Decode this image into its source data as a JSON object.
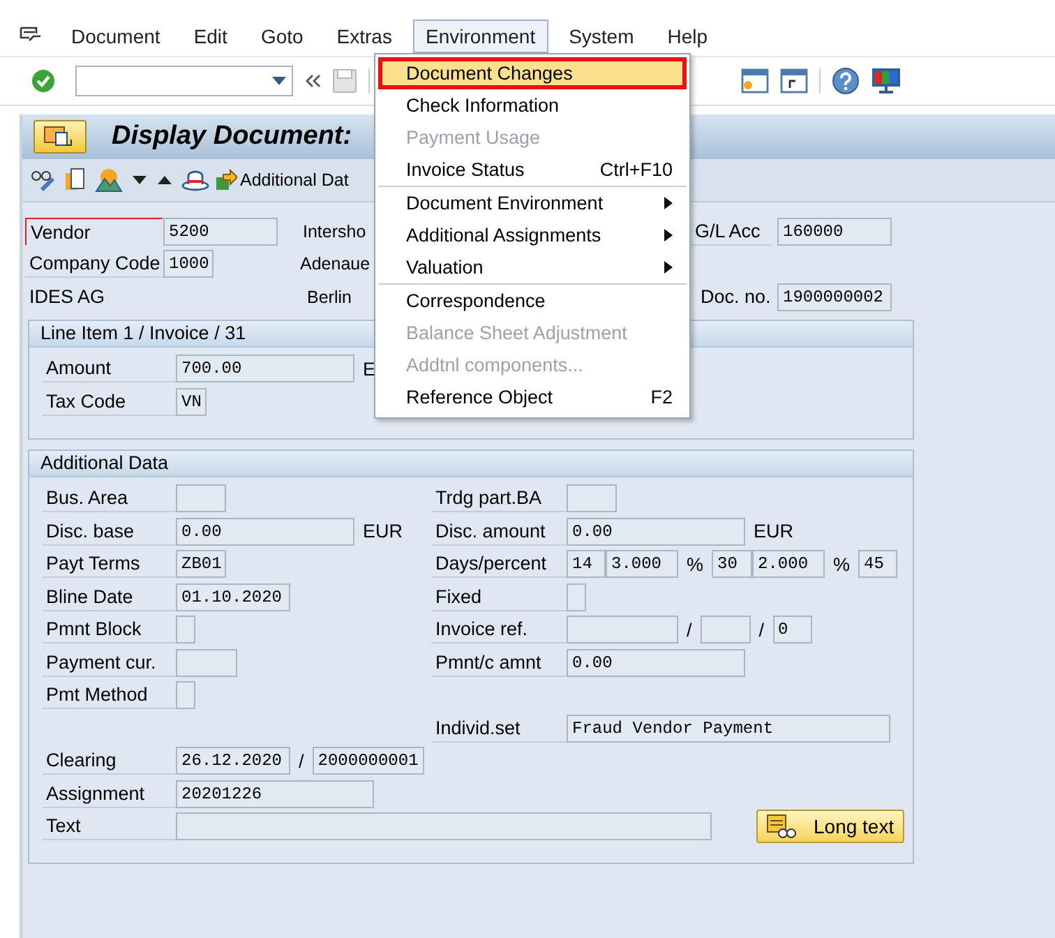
{
  "menu_bar": {
    "items": [
      {
        "label": "Document",
        "selected": false
      },
      {
        "label": "Edit",
        "selected": false
      },
      {
        "label": "Goto",
        "selected": false
      },
      {
        "label": "Extras",
        "selected": false
      },
      {
        "label": "Environment",
        "selected": true
      },
      {
        "label": "System",
        "selected": false
      },
      {
        "label": "Help",
        "selected": false
      }
    ]
  },
  "title": "Display Document:",
  "app_toolbar": {
    "button": "Additional Dat"
  },
  "header": {
    "vendor": {
      "label": "Vendor",
      "value": "5200"
    },
    "company_code": {
      "label": "Company Code",
      "value": "1000"
    },
    "company_name": "IDES AG",
    "vendor_lines": [
      "Intersho",
      "Adenaue",
      "Berlin"
    ],
    "gl_account": {
      "label": "G/L Acc",
      "value": "160000"
    },
    "document_number": {
      "label": "Doc. no.",
      "value": "1900000002"
    }
  },
  "line_item": {
    "title": "Line Item 1 / Invoice / 31",
    "rows": [
      {
        "label": "Amount",
        "parts": [
          {
            "kind": "field",
            "value": "700.00"
          },
          {
            "kind": "text",
            "text": "E"
          }
        ]
      },
      {
        "label": "Tax Code",
        "parts": [
          {
            "kind": "field",
            "value": "VN"
          }
        ]
      }
    ]
  },
  "additional_data": {
    "title": "Additional Data",
    "left": [
      {
        "label": "Bus. Area",
        "parts": [
          {
            "kind": "field"
          }
        ]
      },
      {
        "label": "Disc. base",
        "parts": [
          {
            "kind": "field",
            "value": "0.00"
          },
          {
            "kind": "text",
            "text": "EUR"
          }
        ]
      },
      {
        "label": "Payt Terms",
        "parts": [
          {
            "kind": "field",
            "value": "ZB01"
          }
        ]
      },
      {
        "label": "Bline Date",
        "parts": [
          {
            "kind": "field",
            "value": "01.10.2020"
          }
        ]
      },
      {
        "label": "Pmnt Block",
        "parts": [
          {
            "kind": "field"
          }
        ]
      },
      {
        "label": "Payment cur.",
        "parts": [
          {
            "kind": "field"
          }
        ]
      },
      {
        "label": "Pmt Method",
        "parts": [
          {
            "kind": "field"
          }
        ]
      }
    ],
    "right": [
      {
        "label": "Trdg part.BA",
        "parts": [
          {
            "kind": "field"
          }
        ]
      },
      {
        "label": "Disc. amount",
        "parts": [
          {
            "kind": "field",
            "value": "0.00"
          },
          {
            "kind": "text",
            "text": "EUR"
          }
        ]
      },
      {
        "label": "Days/percent",
        "parts": [
          {
            "kind": "field",
            "value": "14"
          },
          {
            "kind": "field",
            "value": "3.000"
          },
          {
            "kind": "text",
            "text": "%"
          },
          {
            "kind": "field",
            "value": "30"
          },
          {
            "kind": "field",
            "value": "2.000"
          },
          {
            "kind": "text",
            "text": "%"
          },
          {
            "kind": "field",
            "value": "45"
          }
        ]
      },
      {
        "label": "Fixed",
        "parts": [
          {
            "kind": "field"
          }
        ]
      },
      {
        "label": "Invoice ref.",
        "parts": [
          {
            "kind": "field"
          },
          {
            "kind": "text",
            "text": "/"
          },
          {
            "kind": "field"
          },
          {
            "kind": "text",
            "text": "/"
          },
          {
            "kind": "field",
            "value": "0"
          }
        ]
      },
      {
        "label": "Pmnt/c amnt",
        "parts": [
          {
            "kind": "field",
            "value": "0.00"
          }
        ]
      },
      {
        "label": "Individ.set",
        "parts": [
          {
            "kind": "field",
            "value": "Fraud Vendor Payment"
          }
        ]
      }
    ],
    "bottom": [
      {
        "label": "Clearing",
        "parts": [
          {
            "kind": "field",
            "value": "26.12.2020"
          },
          {
            "kind": "text",
            "text": "/"
          },
          {
            "kind": "field",
            "value": "2000000001"
          }
        ]
      },
      {
        "label": "Assignment",
        "parts": [
          {
            "kind": "field",
            "value": "20201226"
          }
        ]
      },
      {
        "label": "Text",
        "parts": [
          {
            "kind": "field"
          },
          {
            "kind": "button",
            "text": "Long text"
          }
        ]
      }
    ]
  },
  "dropdown": {
    "groups": [
      [
        {
          "label": "Document Changes",
          "submenu": false,
          "disabled": false,
          "selected": true
        },
        {
          "label": "Check Information",
          "submenu": false,
          "disabled": false,
          "selected": false
        },
        {
          "label": "Payment Usage",
          "submenu": false,
          "disabled": true,
          "selected": false
        },
        {
          "label": "Invoice Status",
          "shortcut": "Ctrl+F10",
          "submenu": false,
          "disabled": false,
          "selected": false
        }
      ],
      [
        {
          "label": "Document Environment",
          "submenu": true,
          "disabled": false,
          "selected": false
        },
        {
          "label": "Additional Assignments",
          "submenu": true,
          "disabled": false,
          "selected": false
        },
        {
          "label": "Valuation",
          "submenu": true,
          "disabled": false,
          "selected": false
        }
      ],
      [
        {
          "label": "Correspondence",
          "submenu": false,
          "disabled": false,
          "selected": false
        },
        {
          "label": "Balance Sheet Adjustment",
          "submenu": false,
          "disabled": true,
          "selected": false
        },
        {
          "label": "Addtnl components...",
          "submenu": false,
          "disabled": true,
          "selected": false
        },
        {
          "label": "Reference Object",
          "shortcut": "F2",
          "submenu": false,
          "disabled": false,
          "selected": false
        }
      ]
    ]
  }
}
